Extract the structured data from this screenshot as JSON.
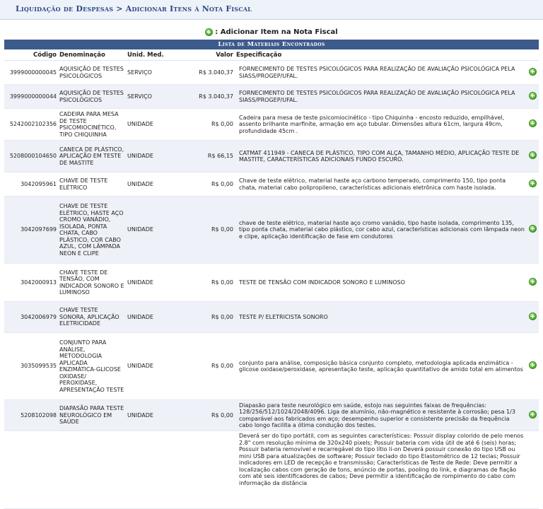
{
  "breadcrumb": "Liquidação de Despesas > Adicionar Itens à Nota Fiscal",
  "action": {
    "label": ": Adicionar Item na Nota Fiscal"
  },
  "list_title": "Lista de Materiais Encontrados",
  "columns": {
    "code": "Código",
    "denomination": "Denominação",
    "unit": "Unid. Med.",
    "value": "Valor",
    "spec": "Especificação"
  },
  "rows": [
    {
      "code": "3999000000045",
      "denomination": "AQUISIÇÃO DE TESTES PSICOLÓGICOS",
      "unit": "SERVIÇO",
      "value": "R$ 3.040,37",
      "spec": "FORNECIMENTO DE TESTES PSICOLÓGICOS PARA REALIZAÇÃO DE AVALIAÇÃO PSICOLÓGICA PELA SIASS/PROGEP/UFAL."
    },
    {
      "code": "3999000000044",
      "denomination": "AQUISIÇÃO DE TESTES PSICOLÓGICOS",
      "unit": "SERVIÇO",
      "value": "R$ 3.040,37",
      "spec": "FORNECIMENTO DE TESTES PSICOLÓGICOS PARA REALIZAÇÃO DE AVALIAÇÃO PSICOLÓGICA PELA SIASS/PROGEP/UFAL."
    },
    {
      "code": "5242002102356",
      "denomination": "CADEIRA PARA MESA DE TESTE PSICOMIOCINÉTICO, TIPO CHIQUINHA",
      "unit": "UNIDADE",
      "value": "R$ 0,00",
      "spec": "Cadeira para mesa de teste psicomiocinético - tipo Chiquinha - encosto reduzido, empilhável, assento brilhante marfinite, armação em aço tubular. Dimensões altura 61cm, largura 49cm, profundidade 45cm ."
    },
    {
      "code": "5208000104650",
      "denomination": "CANECA DE PLÁSTICO, APLICAÇÃO EM TESTE DE MASTITE",
      "unit": "UNIDADE",
      "value": "R$ 66,15",
      "spec": "CATMAT 411949 - CANECA DE PLÁSTICO, TIPO COM ALÇA, TAMANHO MÉDIO, APLICAÇÃO TESTE DE MASTITE, CARACTERÍSTICAS ADICIONAIS FUNDO ESCURO."
    },
    {
      "code": "3042095961",
      "denomination": "CHAVE DE TESTE ELÉTRICO",
      "unit": "UNIDADE",
      "value": "R$ 0,00",
      "spec": "Chave de teste elétrico, material haste aço carbono temperado, comprimento 150, tipo ponta chata, material cabo polipropileno, características adicionais eletrônica com haste isolada."
    },
    {
      "code": "3042097699",
      "denomination": "CHAVE DE TESTE ELÉTRICO, HASTE AÇO CROMO VANÁDIO, ISOLADA, PONTA CHATA, CABO PLÁSTICO, COR CABO AZUL, COM LÂMPADA NEON E CLIPE",
      "unit": "UNIDADE",
      "value": "R$ 0,00",
      "spec": "chave de teste elétrico, material haste aço cromo vanádio, tipo haste isolada, comprimento 135, tipo ponta chata, material cabo plástico, cor cabo azul, características adicionais com lâmpada neon e clipe, aplicação identificação de fase em condutores"
    },
    {
      "code": "3042000913",
      "denomination": "CHAVE TESTE DE TENSÃO, COM INDICADOR SONORO E LUMINOSO",
      "unit": "UNIDADE",
      "value": "R$ 0,00",
      "spec": "TESTE DE TENSÃO COM INDICADOR SONORO E LUMINOSO"
    },
    {
      "code": "3042006979",
      "denomination": "CHAVE TESTE SONORA, APLICAÇÃO ELETRICIDADE",
      "unit": "UNIDADE",
      "value": "R$ 0,00",
      "spec": "TESTE P/ ELETRICISTA SONORO"
    },
    {
      "code": "3035099535",
      "denomination": "CONJUNTO PARA ANÁLISE, METODOLOGIA APLICADA ENZIMÁTICA-GLICOSE OXIDASE/ PEROXIDASE, APRESENTAÇÃO TESTE",
      "unit": "UNIDADE",
      "value": "R$ 0,00",
      "spec": "conjunto para análise, composição básica conjunto completo, metodologia aplicada enzimática - glicose oxidase/peroxidase, apresentação teste, aplicação quantitativo de amido total em alimentos"
    },
    {
      "code": "5208102098",
      "denomination": "DIAPASÃO PARA TESTE NEUROLÓGICO EM SAÚDE",
      "unit": "UNIDADE",
      "value": "R$ 0,00",
      "spec": "Diapasão para teste neurológico em saúde, estojo nas seguintes faixas de frequências: 128/256/512/1024/2048/4096. Liga de alumínio, não-magnético e resistente à corrosão; pesa 1/3 comparável aos fabricados em aço; desempenho superior e consistente precisão da frequência cabo longo facilita a ótima condução dos testes."
    },
    {
      "code": "",
      "denomination": "",
      "unit": "",
      "value": "",
      "spec": "Deverá ser do tipo portátil, com as seguintes características: Possuir display colorido de pelo menos 2.8\" com resolução mínima de 320x240 pixels; Possuir bateria com vida útil de até 6 (seis) horas; Possuir bateria removível e recarregável do tipo lítio li-on Deverá possuir conexão do tipo USB ou mini USB para atualizações de software; Possuir teclado do tipo Elastométrico de 12 teclas; Possuir indicadores em LED de recepção e transmissão; Características de Teste de Rede: Deve permitir a localização cabos com geração de tons, anúncio de portas, pooling do link, e diagramas de fiação com até seis identificadores de cabos; Deve permitir a identificação de rompimento do cabo com informação da distância"
    }
  ]
}
